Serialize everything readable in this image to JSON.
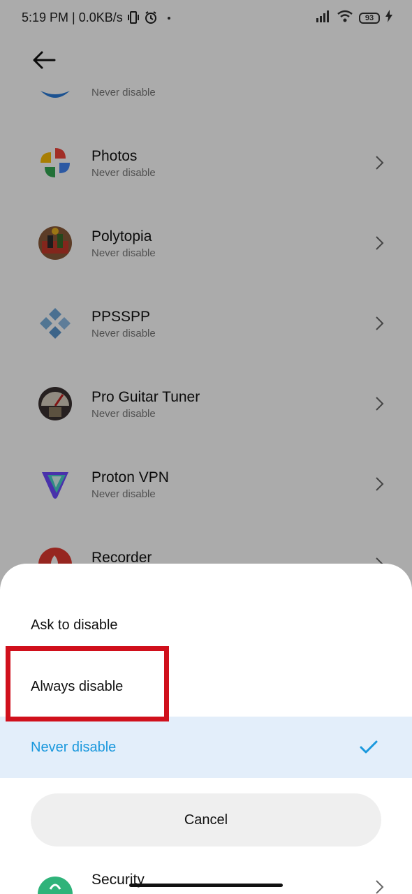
{
  "status_bar": {
    "time_network": "5:19 PM | 0.0KB/s",
    "battery": "93"
  },
  "apps": [
    {
      "name": "",
      "status": "Never disable",
      "icon": "blue-app-icon"
    },
    {
      "name": "Photos",
      "status": "Never disable",
      "icon": "google-photos-icon"
    },
    {
      "name": "Polytopia",
      "status": "Never disable",
      "icon": "polytopia-icon"
    },
    {
      "name": "PPSSPP",
      "status": "Never disable",
      "icon": "ppsspp-icon"
    },
    {
      "name": "Pro Guitar Tuner",
      "status": "Never disable",
      "icon": "guitar-tuner-icon"
    },
    {
      "name": "Proton VPN",
      "status": "Never disable",
      "icon": "proton-vpn-icon"
    },
    {
      "name": "Recorder",
      "status": "",
      "icon": "recorder-icon"
    }
  ],
  "sheet": {
    "options": [
      {
        "label": "Ask to disable",
        "selected": false
      },
      {
        "label": "Always disable",
        "selected": false
      },
      {
        "label": "Never disable",
        "selected": true
      }
    ],
    "cancel_label": "Cancel"
  },
  "peek_item": {
    "name": "Security"
  },
  "colors": {
    "accent": "#1a98dd",
    "selected_bg": "#e3eefa",
    "highlight": "#d0101c",
    "scrim": "rgba(0,0,0,0.33)"
  }
}
